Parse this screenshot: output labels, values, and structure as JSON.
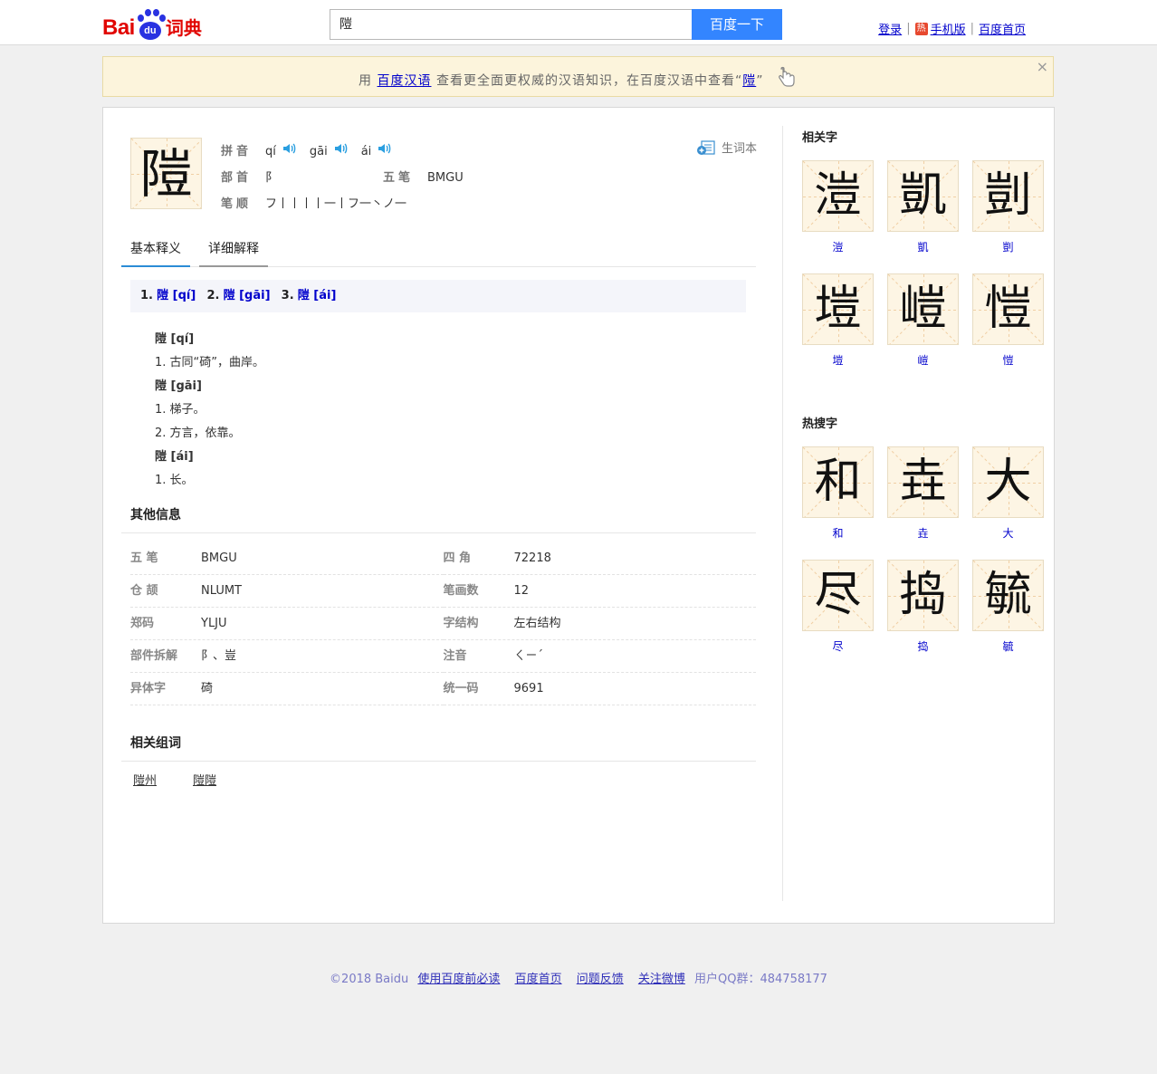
{
  "header": {
    "logo_bai": "Bai",
    "logo_du": "du",
    "logo_cidian": "词典",
    "search_value": "隑",
    "search_button": "百度一下",
    "links": {
      "login": "登录",
      "hot_badge": "热",
      "mobile": "手机版",
      "home": "百度首页"
    }
  },
  "notice": {
    "prefix": "用",
    "link_text": "百度汉语",
    "middle": "查看更全面更权威的汉语知识，在百度汉语中查看“",
    "char_link": "隑",
    "suffix": "”",
    "close": "×"
  },
  "entry": {
    "character": "隑",
    "pinyin_label": "拼音",
    "pinyin": [
      "qí",
      "gāi",
      "ái"
    ],
    "radical_label": "部首",
    "radical": "阝",
    "wubi_label": "五笔",
    "wubi": "BMGU",
    "stroke_label": "笔顺",
    "strokes": "フ丨丨丨丨一丨フ一丶ノ一",
    "vocab_label": "生词本"
  },
  "tabs": [
    "基本释义",
    "详细解释"
  ],
  "summary": [
    {
      "num": "1.",
      "text": "隑 [qí]"
    },
    {
      "num": "2.",
      "text": "隑 [gāi]"
    },
    {
      "num": "3.",
      "text": "隑 [ái]"
    }
  ],
  "definitions": [
    {
      "head": "隑 [qí]",
      "items": [
        "1. 古同“碕”，曲岸。"
      ]
    },
    {
      "head": "隑 [gāi]",
      "items": [
        "1. 梯子。",
        "2. 方言，依靠。"
      ]
    },
    {
      "head": "隑 [ái]",
      "items": [
        "1. 长。"
      ]
    }
  ],
  "other_info": {
    "title": "其他信息",
    "rows": [
      [
        {
          "k": "五 笔",
          "v": "BMGU"
        },
        {
          "k": "四 角",
          "v": "72218"
        }
      ],
      [
        {
          "k": "仓 颉",
          "v": "NLUMT"
        },
        {
          "k": "笔画数",
          "v": "12"
        }
      ],
      [
        {
          "k": "郑码",
          "v": "YLJU"
        },
        {
          "k": "字结构",
          "v": "左右结构"
        }
      ],
      [
        {
          "k": "部件拆解",
          "v": "阝、豈"
        },
        {
          "k": "注音",
          "v": "ㄑㄧˊ"
        }
      ],
      [
        {
          "k": "异体字",
          "v": "碕"
        },
        {
          "k": "统一码",
          "v": "9691"
        }
      ]
    ]
  },
  "related_words": {
    "title": "相关组词",
    "words": [
      "隑州",
      "隑隑"
    ]
  },
  "sidebar": {
    "related_title": "相关字",
    "related": [
      "溰",
      "凱",
      "剴",
      "塏",
      "嵦",
      "愷"
    ],
    "hot_title": "热搜字",
    "hot": [
      "和",
      "垚",
      "大",
      "尽",
      "捣",
      "毓"
    ]
  },
  "footer": {
    "copyright": "©2018 Baidu",
    "links": [
      "使用百度前必读",
      "百度首页",
      "问题反馈",
      "关注微博"
    ],
    "qq": "用户QQ群：484758177"
  }
}
